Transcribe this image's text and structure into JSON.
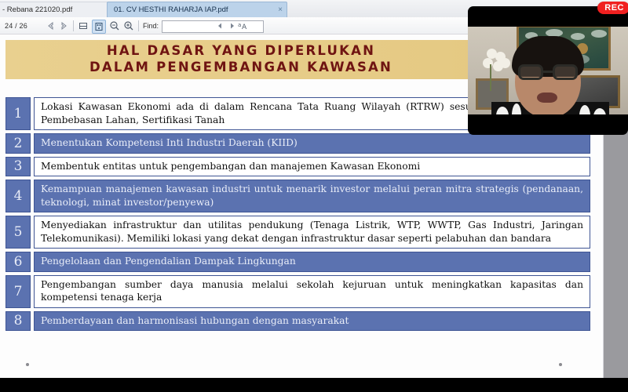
{
  "app": {
    "tabs": [
      {
        "label": "- Rebana 221020.pdf",
        "close": "×",
        "active": false
      },
      {
        "label": "01. CV  HESTHI RAHARJA IAP.pdf",
        "close": "×",
        "active": true
      }
    ],
    "toolbar": {
      "current_page": "24",
      "page_separator": "/ 26",
      "find_label": "Find:",
      "find_value": "",
      "find_placeholder": "",
      "icons": [
        "previous-page-icon",
        "next-page-icon",
        "fit-width-icon",
        "fit-page-icon",
        "zoom-out-icon",
        "zoom-in-icon",
        "find-previous-icon",
        "find-next-icon",
        "match-case-icon"
      ],
      "match_case_label": "A"
    }
  },
  "slide": {
    "title_line1": "HAL DASAR YANG DIPERLUKAN",
    "title_line2": "DALAM PENGEMBANGAN KAWASAN",
    "title_color": "#6f1412",
    "band_color": "#e6cb86",
    "accent_blue": "#5b72b0",
    "items": [
      {
        "number": "1",
        "text": "Lokasi Kawasan Ekonomi ada di dalam Rencana Tata Ruang Wilayah (RTRW) sesuai peruntukan Lokasi, Pembebasan Lahan, Sertifikasi Tanah",
        "style": "light"
      },
      {
        "number": "2",
        "text": "Menentukan Kompetensi Inti Industri Daerah (KIID)",
        "style": "dark"
      },
      {
        "number": "3",
        "text": "Membentuk entitas untuk pengembangan dan manajemen Kawasan Ekonomi",
        "style": "light"
      },
      {
        "number": "4",
        "text": "Kemampuan manajemen kawasan industri untuk menarik investor melalui peran mitra strategis (pendanaan, teknologi, minat investor/penyewa)",
        "style": "dark"
      },
      {
        "number": "5",
        "text": "Menyediakan infrastruktur dan utilitas pendukung (Tenaga Listrik, WTP, WWTP, Gas Industri, Jaringan Telekomunikasi). Memiliki lokasi yang dekat dengan infrastruktur dasar seperti pelabuhan dan bandara",
        "style": "light"
      },
      {
        "number": "6",
        "text": "Pengelolaan dan Pengendalian Dampak Lingkungan",
        "style": "dark"
      },
      {
        "number": "7",
        "text": "Pengembangan sumber daya manusia melalui sekolah kejuruan untuk meningkatkan kapasitas dan kompetensi tenaga kerja",
        "style": "light"
      },
      {
        "number": "8",
        "text": "Pemberdayaan dan harmonisasi hubungan dengan masyarakat",
        "style": "dark"
      }
    ]
  },
  "video": {
    "recording_label": "REC",
    "recording_color": "#f02020"
  }
}
